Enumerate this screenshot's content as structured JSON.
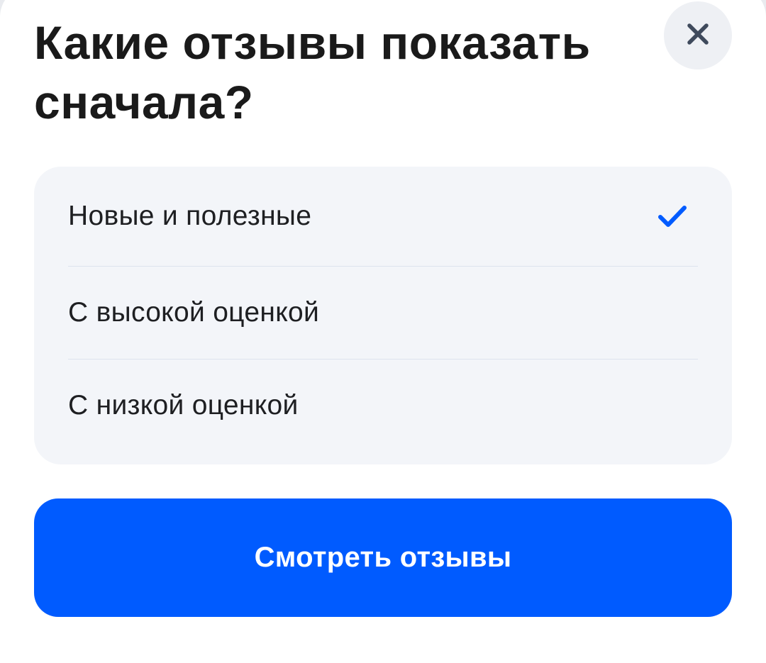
{
  "dialog": {
    "title": "Какие отзывы показать сначала?",
    "close_icon": "close-icon"
  },
  "sort_options": [
    {
      "label": "Новые и полезные",
      "selected": true
    },
    {
      "label": "С высокой оценкой",
      "selected": false
    },
    {
      "label": "С низкой оценкой",
      "selected": false
    }
  ],
  "check_icon": "checkmark-icon",
  "submit_button": {
    "label": "Смотреть отзывы"
  },
  "colors": {
    "accent": "#005bff",
    "options_background": "#f3f5f9",
    "close_background": "#eef0f4",
    "title_text": "#1a1a1a"
  }
}
